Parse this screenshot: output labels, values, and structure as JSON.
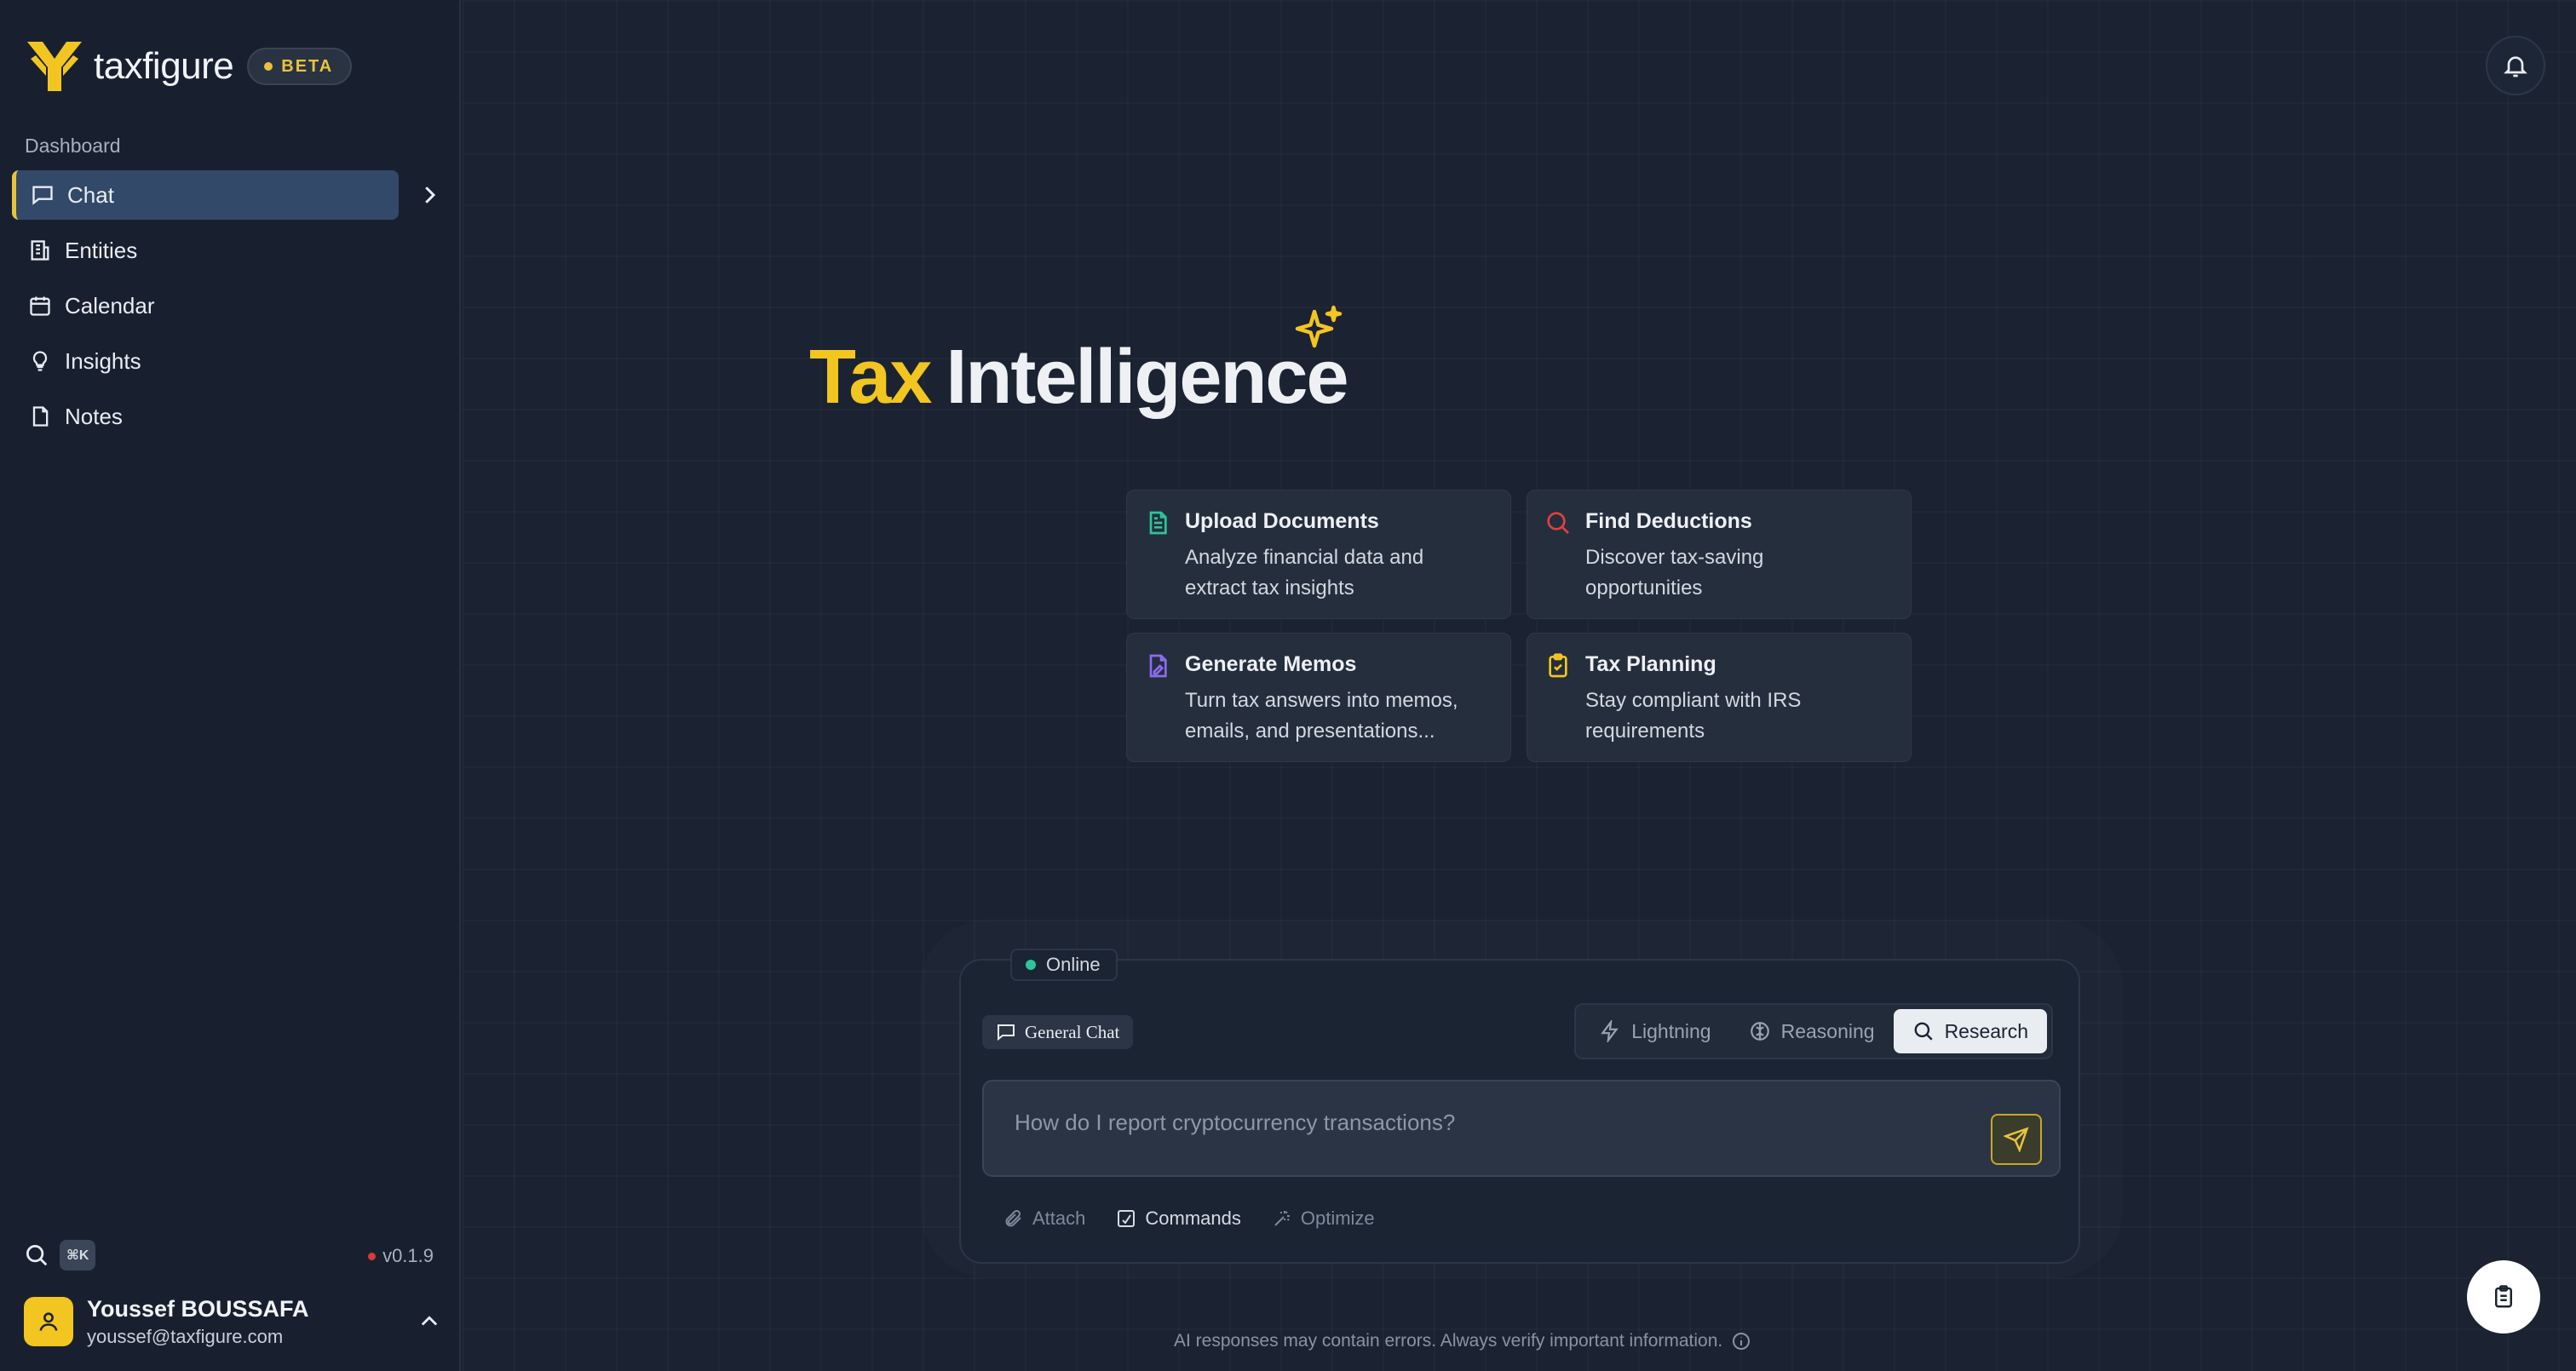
{
  "brand": {
    "name": "taxfigure",
    "badge": "BETA"
  },
  "sidebar": {
    "section_label": "Dashboard",
    "items": [
      {
        "label": "Chat",
        "icon": "chat-icon",
        "active": true
      },
      {
        "label": "Entities",
        "icon": "building-icon",
        "active": false
      },
      {
        "label": "Calendar",
        "icon": "calendar-icon",
        "active": false
      },
      {
        "label": "Insights",
        "icon": "lightbulb-icon",
        "active": false
      },
      {
        "label": "Notes",
        "icon": "file-icon",
        "active": false
      }
    ],
    "shortcut": "⌘K",
    "version": "v0.1.9"
  },
  "user": {
    "name": "Youssef BOUSSAFA",
    "email": "youssef@taxfigure.com"
  },
  "hero": {
    "word1": "Tax",
    "word2": "Intelligence"
  },
  "cards": [
    {
      "title": "Upload Documents",
      "desc_line1": "Analyze financial data and",
      "desc_line2": "extract tax insights",
      "icon": "document-icon",
      "color": "#2ec49b"
    },
    {
      "title": "Find Deductions",
      "desc_line1": "Discover tax-saving",
      "desc_line2": "opportunities",
      "icon": "search-icon",
      "color": "#e0413f"
    },
    {
      "title": "Generate Memos",
      "desc_line1": "Turn tax answers into memos,",
      "desc_line2": "emails, and presentations...",
      "icon": "memo-icon",
      "color": "#8b6cf0"
    },
    {
      "title": "Tax Planning",
      "desc_line1": "Stay compliant with IRS",
      "desc_line2": "requirements",
      "icon": "clipboard-check-icon",
      "color": "#f2c521"
    }
  ],
  "composer": {
    "status": "Online",
    "mode_chip": "General Chat",
    "modes": [
      {
        "label": "Lightning",
        "active": false
      },
      {
        "label": "Reasoning",
        "active": false
      },
      {
        "label": "Research",
        "active": true
      }
    ],
    "placeholder": "How do I report cryptocurrency transactions?",
    "tools": [
      {
        "label": "Attach",
        "enabled": false
      },
      {
        "label": "Commands",
        "enabled": true
      },
      {
        "label": "Optimize",
        "enabled": false
      }
    ]
  },
  "disclaimer": "AI responses may contain errors. Always verify important information.",
  "colors": {
    "accent": "#f2c521",
    "background": "#1b2332",
    "sidebar": "#182030",
    "active_nav": "#33496a",
    "online": "#2ec49b"
  }
}
